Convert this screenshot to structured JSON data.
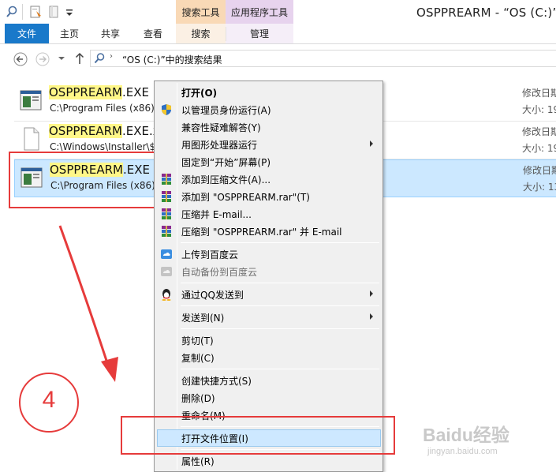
{
  "window": {
    "title": "OSPPREARM - “OS (C:)”中",
    "context_tab_search": "搜索工具",
    "context_tab_app": "应用程序工具"
  },
  "ribbon": {
    "tabs": [
      "文件",
      "主页",
      "共享",
      "查看",
      "搜索",
      "管理"
    ]
  },
  "address": {
    "path": "“OS (C:)”中的搜索结果"
  },
  "results": [
    {
      "name_highlight": "OSPPREARM",
      "name_rest": ".EXE",
      "path": "C:\\Program Files (x86)\\",
      "meta_label": "修改日期",
      "size_label": "大小: ",
      "size_value": "19",
      "icon": "exe-icon",
      "selected": false
    },
    {
      "name_highlight": "OSPPREARM",
      "name_rest": ".EXE.x",
      "path": "C:\\Windows\\Installer\\$",
      "meta_label": "修改日期",
      "size_label": "大小: ",
      "size_value": "19",
      "icon": "blank-file-icon",
      "selected": false
    },
    {
      "name_highlight": "OSPPREARM",
      "name_rest": ".EXE",
      "path": "C:\\Program Files (x86)\\",
      "meta_label": "修改日期",
      "size_label": "大小: ",
      "size_value": "13",
      "icon": "exe-icon",
      "selected": true
    }
  ],
  "context_menu": {
    "items": [
      {
        "label": "打开(O)",
        "bold": true,
        "icon": "",
        "submenu": false
      },
      {
        "label": "以管理员身份运行(A)",
        "icon": "uac-shield-icon",
        "submenu": false
      },
      {
        "label": "兼容性疑难解答(Y)",
        "icon": "",
        "submenu": false
      },
      {
        "label": "用图形处理器运行",
        "icon": "",
        "submenu": true
      },
      {
        "label": "固定到“开始”屏幕(P)",
        "icon": "",
        "submenu": false
      },
      {
        "label": "添加到压缩文件(A)...",
        "icon": "winrar-icon",
        "submenu": false
      },
      {
        "label": "添加到 \"OSPPREARM.rar\"(T)",
        "icon": "winrar-icon",
        "submenu": false
      },
      {
        "label": "压缩并 E-mail...",
        "icon": "winrar-icon",
        "submenu": false
      },
      {
        "label": "压缩到 \"OSPPREARM.rar\" 并 E-mail",
        "icon": "winrar-icon",
        "submenu": false
      },
      {
        "label": "上传到百度云",
        "icon": "baidu-cloud-icon",
        "submenu": false
      },
      {
        "label": "自动备份到百度云",
        "icon": "baidu-cloud-gray-icon",
        "disabled": true,
        "submenu": false
      },
      {
        "label": "通过QQ发送到",
        "icon": "qq-penguin-icon",
        "submenu": true
      },
      {
        "label": "发送到(N)",
        "icon": "",
        "submenu": true
      },
      {
        "label": "剪切(T)",
        "icon": "",
        "submenu": false
      },
      {
        "label": "复制(C)",
        "icon": "",
        "submenu": false
      },
      {
        "label": "创建快捷方式(S)",
        "icon": "",
        "submenu": false
      },
      {
        "label": "删除(D)",
        "icon": "",
        "submenu": false
      },
      {
        "label": "重命名(M)",
        "icon": "",
        "submenu": false
      },
      {
        "label": "打开文件位置(I)",
        "icon": "",
        "submenu": false,
        "hover": true
      },
      {
        "label": "属性(R)",
        "icon": "",
        "submenu": false
      }
    ]
  },
  "annotation": {
    "step_number": "4",
    "color": "#e63b3b"
  },
  "watermark": {
    "logo": "Baidu经验",
    "sub": "jingyan.baidu.com"
  },
  "colors": {
    "file_tab": "#1979ca",
    "selection": "#cce8ff",
    "highlight": "#fff788",
    "search_tools": "#f9d9b6",
    "app_tools": "#e7d3ee"
  }
}
